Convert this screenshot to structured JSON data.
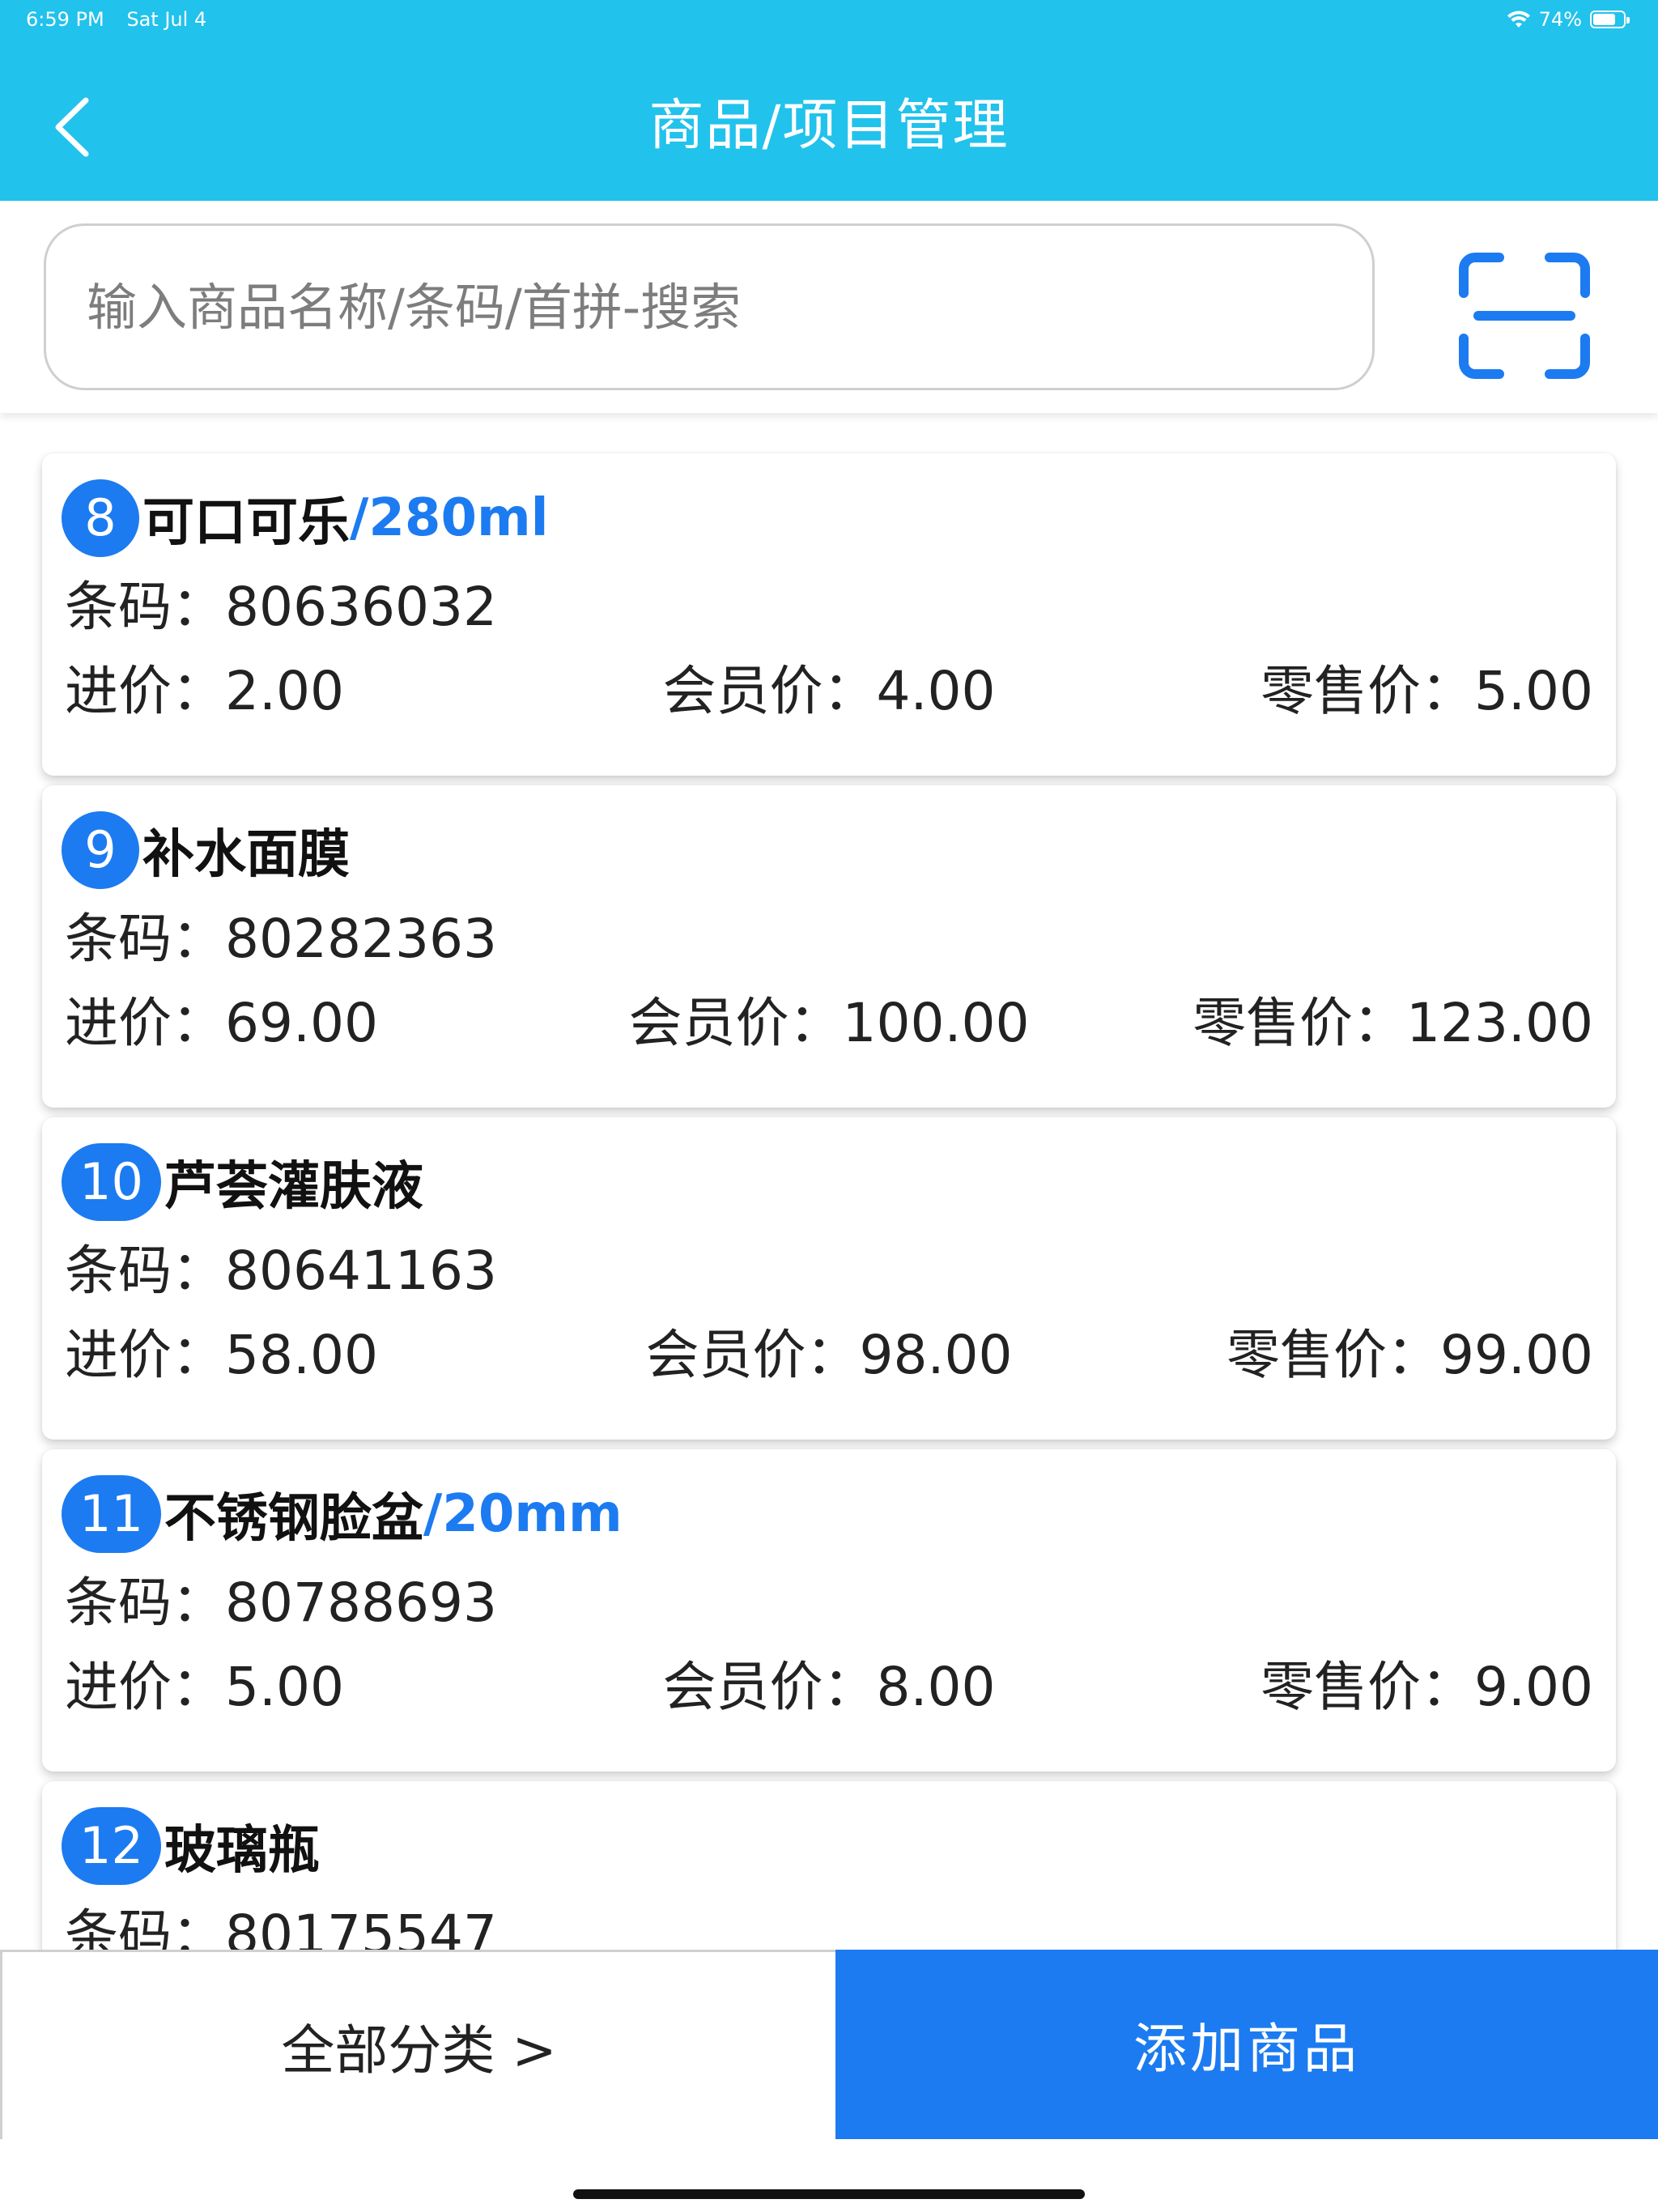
{
  "status_bar": {
    "time": "6:59 PM",
    "date": "Sat Jul 4",
    "battery": "74%",
    "battery_level": 0.74,
    "wifi_icon": "wifi-icon",
    "battery_icon": "battery-icon"
  },
  "header": {
    "title": "商品/项目管理",
    "back_icon": "chevron-left-icon",
    "background_color": "#21C2EC"
  },
  "search": {
    "placeholder": "输入商品名称/条码/首拼-搜索",
    "value": "",
    "scan_icon": "scan-icon"
  },
  "labels": {
    "barcode": "条码：",
    "purchase_price": "进价：",
    "member_price": "会员价：",
    "retail_price": "零售价："
  },
  "products": [
    {
      "index": "8",
      "name": "可口可乐",
      "spec": "/280ml",
      "barcode": "80636032",
      "purchase_price": "2.00",
      "member_price": "4.00",
      "retail_price": "5.00"
    },
    {
      "index": "9",
      "name": "补水面膜",
      "spec": "",
      "barcode": "80282363",
      "purchase_price": "69.00",
      "member_price": "100.00",
      "retail_price": "123.00"
    },
    {
      "index": "10",
      "name": "芦荟灌肤液",
      "spec": "",
      "barcode": "80641163",
      "purchase_price": "58.00",
      "member_price": "98.00",
      "retail_price": "99.00"
    },
    {
      "index": "11",
      "name": "不锈钢脸盆",
      "spec": "/20mm",
      "barcode": "80788693",
      "purchase_price": "5.00",
      "member_price": "8.00",
      "retail_price": "9.00"
    },
    {
      "index": "12",
      "name": "玻璃瓶",
      "spec": "",
      "barcode": "80175547",
      "purchase_price": "",
      "member_price": "",
      "retail_price": ""
    }
  ],
  "bottom_bar": {
    "category_label": "全部分类 >",
    "add_label": "添加商品",
    "accent_color": "#1C7BF0"
  }
}
